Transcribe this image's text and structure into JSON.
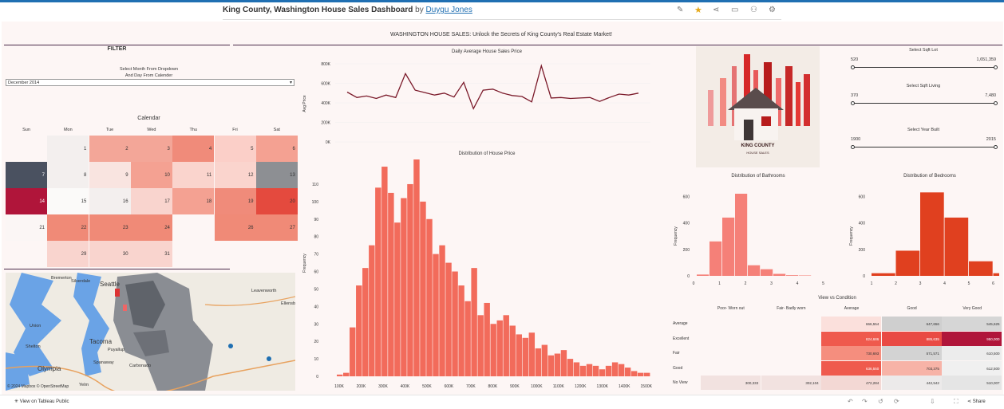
{
  "header": {
    "title": "King County, Washington House Sales Dashboard",
    "by": "by",
    "author": "Duygu Jones"
  },
  "banner": "WASHINGTON HOUSE SALES: Unlock the Secrets of King County's Real Estate Market!",
  "filter": {
    "title": "FILTER",
    "instruction_1": "Select Month From Dropdown",
    "instruction_2": "And Day From Calender",
    "dropdown_value": "December 2014"
  },
  "calendar": {
    "title": "Calendar",
    "days": [
      "Sun",
      "Mon",
      "Tue",
      "Wed",
      "Thu",
      "Fri",
      "Sat"
    ],
    "cells": [
      {
        "d": "1",
        "c": "#f3efee"
      },
      {
        "d": "2",
        "c": "#f3a698"
      },
      {
        "d": "3",
        "c": "#f3a698"
      },
      {
        "d": "4",
        "c": "#f08b7a"
      },
      {
        "d": "5",
        "c": "#fbcfc8"
      },
      {
        "d": "6",
        "c": "#f4a192"
      },
      {
        "d": "7",
        "c": "#4a5160"
      },
      {
        "d": "8",
        "c": "#f3efee"
      },
      {
        "d": "9",
        "c": "#f9e4e0"
      },
      {
        "d": "10",
        "c": "#f4a192"
      },
      {
        "d": "11",
        "c": "#fad4cd"
      },
      {
        "d": "12",
        "c": "#fad4cd"
      },
      {
        "d": "13",
        "c": "#8d8f93"
      },
      {
        "d": "14",
        "c": "#b0153a"
      },
      {
        "d": "15",
        "c": "#fbfaf9"
      },
      {
        "d": "16",
        "c": "#f3efee"
      },
      {
        "d": "17",
        "c": "#f9d4ce"
      },
      {
        "d": "18",
        "c": "#f4a192"
      },
      {
        "d": "19",
        "c": "#f08b7a"
      },
      {
        "d": "20",
        "c": "#e44a3e"
      },
      {
        "d": "21",
        "c": "#fbf6f5"
      },
      {
        "d": "22",
        "c": "#f08a77"
      },
      {
        "d": "23",
        "c": "#f08a77"
      },
      {
        "d": "24",
        "c": "#f08a77"
      },
      {
        "d": "26",
        "c": "#f08a77"
      },
      {
        "d": "27",
        "c": "#f08a77"
      },
      {
        "d": "29",
        "c": "#f9d4ce"
      },
      {
        "d": "30",
        "c": "#f9d4ce"
      },
      {
        "d": "31",
        "c": "#f9d4ce"
      }
    ]
  },
  "map": {
    "credit": "© 2024 Mapbox © OpenStreetMap",
    "places": [
      "Bremerton",
      "Silverdale",
      "Seattle",
      "Leavenworth",
      "Union",
      "Shelton",
      "Tacoma",
      "Puyallup",
      "Olympia",
      "Carbonado",
      "Spanaway",
      "Yelm",
      "Ellensburg"
    ]
  },
  "line_chart": {
    "title": "Daily Average House Sales Price",
    "ylabel": "Avg Price",
    "yticks": [
      "800K",
      "600K",
      "400K",
      "200K",
      "0K"
    ]
  },
  "hist_chart": {
    "title": "Distribution of House Price",
    "ylabel": "Frequency",
    "yticks": [
      "110",
      "100",
      "90",
      "80",
      "70",
      "60",
      "50",
      "40",
      "30",
      "20",
      "10",
      "0"
    ],
    "xticks": [
      "100K",
      "200K",
      "300K",
      "400K",
      "500K",
      "600K",
      "700K",
      "800K",
      "900K",
      "1000K",
      "1100K",
      "1200K",
      "1300K",
      "1400K",
      "1500K"
    ]
  },
  "bath_chart": {
    "title": "Distribution of Bathrooms",
    "ylabel": "Frequency",
    "yticks": [
      "600",
      "400",
      "200",
      "0"
    ],
    "xticks": [
      "0",
      "1",
      "2",
      "3",
      "4",
      "5"
    ]
  },
  "bed_chart": {
    "title": "Distribution of Bedrooms",
    "ylabel": "Frequency",
    "yticks": [
      "600",
      "400",
      "200",
      "0"
    ],
    "xticks": [
      "1",
      "2",
      "3",
      "4",
      "5",
      "6"
    ]
  },
  "logo": {
    "line1": "KING COUNTY",
    "line2": "HOUSE SALES"
  },
  "sliders": [
    {
      "title": "Select Sqft Lot",
      "min": "520",
      "max": "1,651,359"
    },
    {
      "title": "Select Sqft Living",
      "min": "370",
      "max": "7,480"
    },
    {
      "title": "Select Year Built",
      "min": "1900",
      "max": "2015"
    }
  ],
  "heatmap": {
    "title": "View vs Condition",
    "cols": [
      "Poor- Worn out",
      "Fair- Badly worn",
      "Average",
      "Good",
      "Very Good"
    ],
    "rows": [
      {
        "name": "Average",
        "vals": [
          "",
          "",
          "666,554",
          "647,656",
          "545,625"
        ],
        "colors": [
          "",
          "",
          "#fbe0dc",
          "#cfcfcf",
          "#d6d6d6"
        ]
      },
      {
        "name": "Excellent",
        "vals": [
          "",
          "",
          "824,686",
          "885,635",
          "950,000"
        ],
        "colors": [
          "",
          "",
          "#ef5a4d",
          "#e94a44",
          "#b0153a"
        ]
      },
      {
        "name": "Fair",
        "vals": [
          "",
          "",
          "730,693",
          "571,571",
          "610,500"
        ],
        "colors": [
          "",
          "",
          "#f58e7e",
          "#d3d3d3",
          "#ececec"
        ]
      },
      {
        "name": "Good",
        "vals": [
          "",
          "",
          "636,550",
          "703,375",
          "612,500"
        ],
        "colors": [
          "",
          "",
          "#ef5a4d",
          "#f7b3a7",
          "#f0f0f0"
        ]
      },
      {
        "name": "No View",
        "vals": [
          "300,333",
          "302,104",
          "472,284",
          "442,542",
          "510,007"
        ],
        "colors": [
          "#f2e2e0",
          "#f2e2e0",
          "#f3d8d4",
          "#eceaea",
          "#e5e5e5"
        ]
      }
    ]
  },
  "footer": {
    "view": "View on Tableau Public",
    "share": "Share"
  },
  "chart_data": [
    {
      "type": "line",
      "title": "Daily Average House Sales Price",
      "ylabel": "Avg Price",
      "ylim": [
        0,
        800000
      ],
      "values": [
        510000,
        455000,
        470000,
        445000,
        480000,
        455000,
        700000,
        530000,
        505000,
        480000,
        500000,
        460000,
        610000,
        340000,
        530000,
        540000,
        500000,
        475000,
        465000,
        410000,
        780000,
        450000,
        455000,
        445000,
        450000,
        455000,
        415000,
        455000,
        490000,
        480000,
        500000
      ]
    },
    {
      "type": "bar",
      "title": "Distribution of House Price",
      "ylabel": "Frequency",
      "ylim": [
        0,
        115
      ],
      "xrange": [
        100000,
        1500000
      ],
      "values": [
        1,
        2,
        28,
        52,
        62,
        75,
        108,
        120,
        105,
        88,
        102,
        110,
        126,
        100,
        90,
        70,
        75,
        65,
        60,
        52,
        43,
        62,
        35,
        42,
        30,
        32,
        35,
        29,
        24,
        22,
        25,
        16,
        18,
        12,
        13,
        15,
        10,
        8,
        6,
        7,
        6,
        4,
        6,
        8,
        7,
        5,
        3,
        2,
        2
      ]
    },
    {
      "type": "bar",
      "title": "Distribution of Bathrooms",
      "ylabel": "Frequency",
      "categories": [
        "0.5",
        "1",
        "1.5",
        "2",
        "2.5",
        "3",
        "3.5",
        "4",
        "4.5"
      ],
      "values": [
        10,
        260,
        440,
        620,
        80,
        50,
        15,
        5,
        3
      ]
    },
    {
      "type": "bar",
      "title": "Distribution of Bedrooms",
      "ylabel": "Frequency",
      "categories": [
        "1",
        "2",
        "3",
        "4",
        "5",
        "6"
      ],
      "values": [
        20,
        190,
        630,
        440,
        110,
        20
      ]
    }
  ]
}
